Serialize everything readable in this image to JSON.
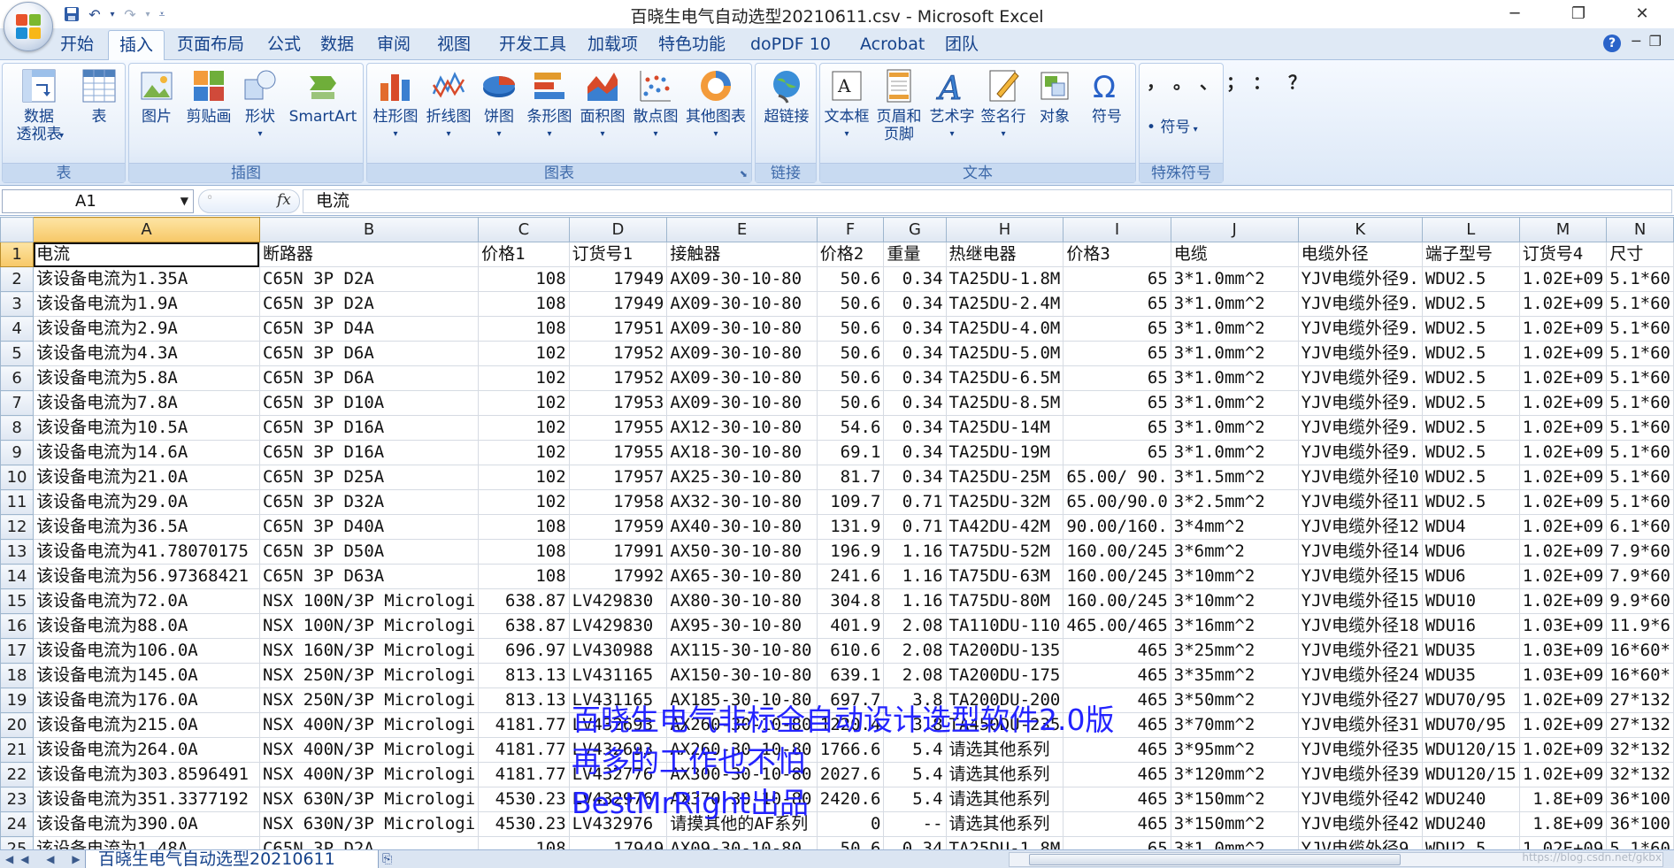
{
  "window": {
    "title": "百晓生电气自动选型20210611.csv - Microsoft Excel",
    "min_glyph": "─",
    "restore_glyph": "❐",
    "close_glyph": "✕"
  },
  "menu": {
    "tabs": [
      "开始",
      "插入",
      "页面布局",
      "公式",
      "数据",
      "审阅",
      "视图",
      "开发工具",
      "加载项",
      "特色功能",
      "doPDF 10",
      "Acrobat",
      "团队"
    ],
    "active_index": 1,
    "help": "?"
  },
  "ribbon": {
    "groups": [
      {
        "label": "表",
        "buttons": [
          "数据\n透视表",
          "表"
        ]
      },
      {
        "label": "插图",
        "buttons": [
          "图片",
          "剪贴画",
          "形状",
          "SmartArt"
        ]
      },
      {
        "label": "图表",
        "buttons": [
          "柱形图",
          "折线图",
          "饼图",
          "条形图",
          "面积图",
          "散点图",
          "其他图表"
        ]
      },
      {
        "label": "链接",
        "buttons": [
          "超链接"
        ]
      },
      {
        "label": "文本",
        "buttons": [
          "文本框",
          "页眉和\n页脚",
          "艺术字",
          "签名行",
          "对象",
          "符号"
        ]
      },
      {
        "label": "特殊符号",
        "buttons": [
          "符号"
        ]
      }
    ],
    "symbol_glyphs": "，。、；：？",
    "pivot_label_1": "数据",
    "pivot_label_2": "透视表",
    "table_label": "表",
    "header_footer_1": "页眉和",
    "header_footer_2": "页脚"
  },
  "formula_bar": {
    "name_box": "A1",
    "fx": "fx",
    "content": "电流"
  },
  "sheet": {
    "columns": [
      "A",
      "B",
      "C",
      "D",
      "E",
      "F",
      "G",
      "H",
      "I",
      "J",
      "K",
      "L",
      "M",
      "N"
    ],
    "selected_column": "A",
    "rows": [
      [
        "电流",
        "断路器",
        "价格1",
        "订货号1",
        "接触器",
        "价格2",
        "重量",
        "热继电器",
        "价格3",
        "电缆",
        "电缆外径",
        "端子型号",
        "订货号4",
        "尺寸"
      ],
      [
        "该设备电流为1.35A",
        "C65N 3P D2A",
        "108",
        "17949",
        "AX09-30-10-80",
        "50.6",
        "0.34",
        "TA25DU-1.8M",
        "65",
        "3*1.0mm^2",
        "YJV电缆外径9.",
        "WDU2.5",
        "1.02E+09",
        "5.1*60"
      ],
      [
        "该设备电流为1.9A",
        "C65N 3P D2A",
        "108",
        "17949",
        "AX09-30-10-80",
        "50.6",
        "0.34",
        "TA25DU-2.4M",
        "65",
        "3*1.0mm^2",
        "YJV电缆外径9.",
        "WDU2.5",
        "1.02E+09",
        "5.1*60"
      ],
      [
        "该设备电流为2.9A",
        "C65N 3P D4A",
        "108",
        "17951",
        "AX09-30-10-80",
        "50.6",
        "0.34",
        "TA25DU-4.0M",
        "65",
        "3*1.0mm^2",
        "YJV电缆外径9.",
        "WDU2.5",
        "1.02E+09",
        "5.1*60"
      ],
      [
        "该设备电流为4.3A",
        "C65N 3P D6A",
        "102",
        "17952",
        "AX09-30-10-80",
        "50.6",
        "0.34",
        "TA25DU-5.0M",
        "65",
        "3*1.0mm^2",
        "YJV电缆外径9.",
        "WDU2.5",
        "1.02E+09",
        "5.1*60"
      ],
      [
        "该设备电流为5.8A",
        "C65N 3P D6A",
        "102",
        "17952",
        "AX09-30-10-80",
        "50.6",
        "0.34",
        "TA25DU-6.5M",
        "65",
        "3*1.0mm^2",
        "YJV电缆外径9.",
        "WDU2.5",
        "1.02E+09",
        "5.1*60"
      ],
      [
        "该设备电流为7.8A",
        "C65N 3P D10A",
        "102",
        "17953",
        "AX09-30-10-80",
        "50.6",
        "0.34",
        "TA25DU-8.5M",
        "65",
        "3*1.0mm^2",
        "YJV电缆外径9.",
        "WDU2.5",
        "1.02E+09",
        "5.1*60"
      ],
      [
        "该设备电流为10.5A",
        "C65N 3P D16A",
        "102",
        "17955",
        "AX12-30-10-80",
        "54.6",
        "0.34",
        "TA25DU-14M",
        "65",
        "3*1.0mm^2",
        "YJV电缆外径9.",
        "WDU2.5",
        "1.02E+09",
        "5.1*60"
      ],
      [
        "该设备电流为14.6A",
        "C65N 3P D16A",
        "102",
        "17955",
        "AX18-30-10-80",
        "69.1",
        "0.34",
        "TA25DU-19M",
        "65",
        "3*1.0mm^2",
        "YJV电缆外径9.",
        "WDU2.5",
        "1.02E+09",
        "5.1*60"
      ],
      [
        "该设备电流为21.0A",
        "C65N 3P D25A",
        "102",
        "17957",
        "AX25-30-10-80",
        "81.7",
        "0.34",
        "TA25DU-25M",
        "65.00/ 90.",
        "3*1.5mm^2",
        "YJV电缆外径10",
        "WDU2.5",
        "1.02E+09",
        "5.1*60"
      ],
      [
        "该设备电流为29.0A",
        "C65N 3P D32A",
        "102",
        "17958",
        "AX32-30-10-80",
        "109.7",
        "0.71",
        "TA25DU-32M",
        "65.00/90.0",
        "3*2.5mm^2",
        "YJV电缆外径11",
        "WDU2.5",
        "1.02E+09",
        "5.1*60"
      ],
      [
        "该设备电流为36.5A",
        "C65N 3P D40A",
        "108",
        "17959",
        "AX40-30-10-80",
        "131.9",
        "0.71",
        "TA42DU-42M",
        "90.00/160.",
        "3*4mm^2",
        "YJV电缆外径12",
        "WDU4",
        "1.02E+09",
        "6.1*60"
      ],
      [
        "该设备电流为41.78070175",
        "C65N 3P D50A",
        "108",
        "17991",
        "AX50-30-10-80",
        "196.9",
        "1.16",
        "TA75DU-52M",
        "160.00/245",
        "3*6mm^2",
        "YJV电缆外径14",
        "WDU6",
        "1.02E+09",
        "7.9*60"
      ],
      [
        "该设备电流为56.97368421",
        "C65N 3P D63A",
        "108",
        "17992",
        "AX65-30-10-80",
        "241.6",
        "1.16",
        "TA75DU-63M",
        "160.00/245",
        "3*10mm^2",
        "YJV电缆外径15",
        "WDU6",
        "1.02E+09",
        "7.9*60"
      ],
      [
        "该设备电流为72.0A",
        "NSX 100N/3P Micrologi",
        "638.87",
        "LV429830",
        "AX80-30-10-80",
        "304.8",
        "1.16",
        "TA75DU-80M",
        "160.00/245",
        "3*10mm^2",
        "YJV电缆外径15",
        "WDU10",
        "1.02E+09",
        "9.9*60"
      ],
      [
        "该设备电流为88.0A",
        "NSX 100N/3P Micrologi",
        "638.87",
        "LV429830",
        "AX95-30-10-80",
        "401.9",
        "2.08",
        "TA110DU-110",
        "465.00/465",
        "3*16mm^2",
        "YJV电缆外径18",
        "WDU16",
        "1.03E+09",
        "11.9*6"
      ],
      [
        "该设备电流为106.0A",
        "NSX 160N/3P Micrologi",
        "696.97",
        "LV430988",
        "AX115-30-10-80",
        "610.6",
        "2.08",
        "TA200DU-135",
        "465",
        "3*25mm^2",
        "YJV电缆外径21",
        "WDU35",
        "1.03E+09",
        "16*60*"
      ],
      [
        "该设备电流为145.0A",
        "NSX 250N/3P Micrologi",
        "813.13",
        "LV431165",
        "AX150-30-10-80",
        "639.1",
        "2.08",
        "TA200DU-175",
        "465",
        "3*35mm^2",
        "YJV电缆外径24",
        "WDU35",
        "1.03E+09",
        "16*60*"
      ],
      [
        "该设备电流为176.0A",
        "NSX 250N/3P Micrologi",
        "813.13",
        "LV431165",
        "AX185-30-10-80",
        "697.7",
        "3.8",
        "TA200DU-200",
        "465",
        "3*50mm^2",
        "YJV电缆外径27",
        "WDU70/95",
        "1.02E+09",
        "27*132"
      ],
      [
        "该设备电流为215.0A",
        "NSX 400N/3P Micrologi",
        "4181.77",
        "LV432693",
        "AX260-30-10-80",
        "1220.4",
        "3.8",
        "TA450DU-235",
        "465",
        "3*70mm^2",
        "YJV电缆外径31",
        "WDU70/95",
        "1.02E+09",
        "27*132"
      ],
      [
        "该设备电流为264.0A",
        "NSX 400N/3P Micrologi",
        "4181.77",
        "LV432693",
        "AX260-30-10-80",
        "1766.6",
        "5.4",
        "请选其他系列",
        "465",
        "3*95mm^2",
        "YJV电缆外径35",
        "WDU120/15",
        "1.02E+09",
        "32*132"
      ],
      [
        "该设备电流为303.8596491",
        "NSX 400N/3P Micrologi",
        "4181.77",
        "LV432776",
        "AX300-30-10-80",
        "2027.6",
        "5.4",
        "请选其他系列",
        "465",
        "3*120mm^2",
        "YJV电缆外径39",
        "WDU120/15",
        "1.02E+09",
        "32*132"
      ],
      [
        "该设备电流为351.3377192",
        "NSX 630N/3P Micrologi",
        "4530.23",
        "LV432976",
        "AX370-30-10-80",
        "2420.6",
        "5.4",
        "请选其他系列",
        "465",
        "3*150mm^2",
        "YJV电缆外径42",
        "WDU240",
        "1.8E+09",
        "36*100"
      ],
      [
        "该设备电流为390.0A",
        "NSX 630N/3P Micrologi",
        "4530.23",
        "LV432976",
        "请摸其他的AF系列",
        "0",
        "--",
        "请选其他系列",
        "465",
        "3*150mm^2",
        "YJV电缆外径42",
        "WDU240",
        "1.8E+09",
        "36*100"
      ],
      [
        "该设备电流为1.48A",
        "C65N 3P D2A",
        "108",
        "17949",
        "AX09-30-10-80",
        "50.6",
        "0.34",
        "TA25DU-1.8M",
        "65",
        "3*1.0mm^2",
        "YJV电缆外径9.",
        "WDU2.5",
        "1.02E+09",
        "5.1*60"
      ]
    ],
    "numeric_columns": [
      2,
      5,
      6,
      8,
      12
    ]
  },
  "overlay": {
    "line1": "百晓生电气非标全自动设计选型软件2.0版",
    "line2": "再多的工作也不怕",
    "line3": "BestMrRight出品",
    "color": "#2323ff"
  },
  "sheet_tabs": {
    "nav": "◀◀ ◀ ▶ ▶▶",
    "active": "百晓生电气自动选型20210611",
    "credit": "https://blog.csdn.net/gkbx"
  }
}
